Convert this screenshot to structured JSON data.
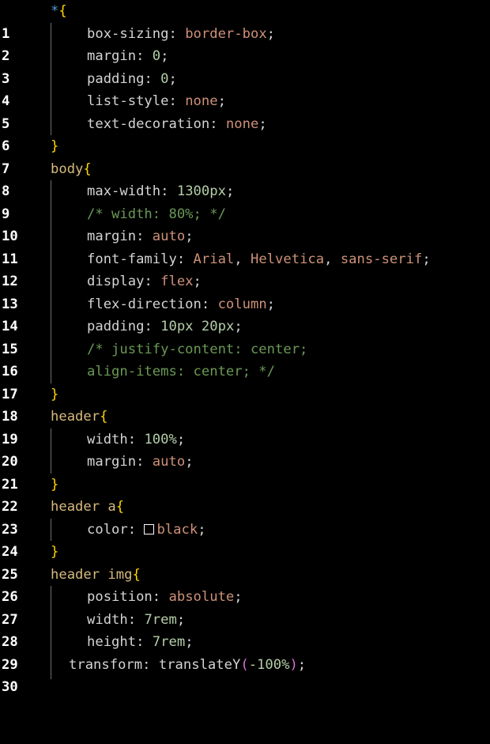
{
  "editor": {
    "language": "css",
    "colors": {
      "background": "#000000",
      "selector": "#d7ba7d",
      "brace": "#ffd700",
      "property": "#d4d4d4",
      "value": "#ce9178",
      "number": "#b5cea8",
      "comment": "#6a9955"
    },
    "lines": [
      {
        "n": "1"
      },
      {
        "n": "2"
      },
      {
        "n": "3"
      },
      {
        "n": "4"
      },
      {
        "n": "5"
      },
      {
        "n": "6"
      },
      {
        "n": "7"
      },
      {
        "n": "8"
      },
      {
        "n": "9"
      },
      {
        "n": "10"
      },
      {
        "n": "11"
      },
      {
        "n": "12"
      },
      {
        "n": "13"
      },
      {
        "n": "14"
      },
      {
        "n": "15"
      },
      {
        "n": "16"
      },
      {
        "n": "17"
      },
      {
        "n": "18"
      },
      {
        "n": "19"
      },
      {
        "n": "20"
      },
      {
        "n": "21"
      },
      {
        "n": "22"
      },
      {
        "n": "23"
      },
      {
        "n": "24"
      },
      {
        "n": "25"
      },
      {
        "n": "26"
      },
      {
        "n": "27"
      },
      {
        "n": "28"
      },
      {
        "n": "29"
      },
      {
        "n": "30"
      }
    ],
    "tokens": {
      "l1_sel": "*",
      "l1_brace": "{",
      "l2_prop": "box-sizing",
      "l2_val": "border-box",
      "l3_prop": "margin",
      "l3_val": "0",
      "l4_prop": "padding",
      "l4_val": "0",
      "l5_prop": "list-style",
      "l5_val": "none",
      "l6_prop": "text-decoration",
      "l6_val": "none",
      "l7_brace": "}",
      "l8_sel": "body",
      "l8_brace": "{",
      "l9_prop": "max-width",
      "l9_val": "1300px",
      "l10_comment": "/* width: 80%; */",
      "l11_prop": "margin",
      "l11_val": "auto",
      "l12_prop": "font-family",
      "l12_v1": "Arial",
      "l12_v2": "Helvetica",
      "l12_v3": "sans-serif",
      "l13_prop": "display",
      "l13_val": "flex",
      "l14_prop": "flex-direction",
      "l14_val": "column",
      "l15_prop": "padding",
      "l15_v1": "10px",
      "l15_v2": "20px",
      "l16_comment": "/* justify-content: center;",
      "l17_comment": "align-items: center; */",
      "l18_brace": "}",
      "l19_sel": "header",
      "l19_brace": "{",
      "l20_prop": "width",
      "l20_val": "100%",
      "l21_prop": "margin",
      "l21_val": "auto",
      "l22_brace": "}",
      "l23_sel": "header a",
      "l23_brace": "{",
      "l24_prop": "color",
      "l24_val": "black",
      "l25_brace": "}",
      "l26_sel": "header img",
      "l26_brace": "{",
      "l27_prop": "position",
      "l27_val": "absolute",
      "l28_prop": "width",
      "l28_val": "7rem",
      "l29_prop": "height",
      "l29_val": "7rem",
      "l30_prop": "transform",
      "l30_fn": "translateY",
      "l30_open": "(",
      "l30_arg": "-100%",
      "l30_close": ")"
    }
  }
}
